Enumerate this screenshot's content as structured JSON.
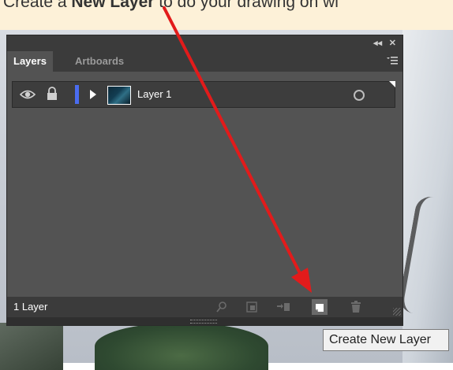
{
  "caption": {
    "prefix": "Create a ",
    "bold": "New Layer",
    "suffix": " to do your drawing on wi"
  },
  "panel": {
    "tabs": [
      {
        "label": "Layers",
        "active": true
      },
      {
        "label": "Artboards",
        "active": false
      }
    ],
    "title_controls": {
      "collapse": "◂◂",
      "close": "✕"
    },
    "menu_icon": "panel-menu-icon",
    "layers": [
      {
        "name": "Layer 1",
        "visible": true,
        "locked": false,
        "color": "#4a6cf0"
      }
    ],
    "footer": {
      "count_label": "1 Layer",
      "buttons": [
        {
          "name": "locate-object",
          "icon": "search-icon",
          "enabled": false
        },
        {
          "name": "make-clipping-mask",
          "icon": "clipping-mask-icon",
          "enabled": false
        },
        {
          "name": "create-sublayer",
          "icon": "sublayer-icon",
          "enabled": false
        },
        {
          "name": "create-new-layer",
          "icon": "new-layer-icon",
          "enabled": true
        },
        {
          "name": "delete-selection",
          "icon": "trash-icon",
          "enabled": false
        }
      ]
    }
  },
  "tooltip": {
    "text": "Create New Layer"
  },
  "colors": {
    "panel_bg": "#535353",
    "panel_dark": "#3b3b3b",
    "layer_color": "#4a6cf0",
    "arrow": "#e21b1b",
    "caption_bg": "#fdf1d8"
  }
}
